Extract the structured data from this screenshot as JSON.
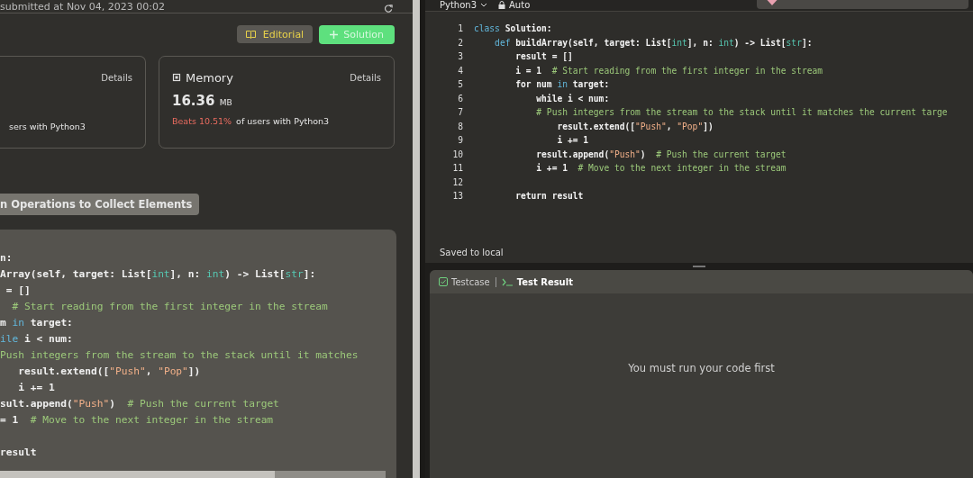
{
  "left": {
    "submitted": "submitted at Nov 04, 2023 00:02",
    "editorial": "Editorial",
    "solution": "Solution",
    "cards": [
      {
        "kind": "runtime",
        "details": "Details",
        "rest": "sers with Python3"
      },
      {
        "kind": "memory",
        "title": "Memory",
        "details": "Details",
        "value": "16.36",
        "unit": "MB",
        "beats": "Beats 10.51%",
        "rest": "of users with Python3"
      }
    ],
    "problem_title": "n Operations to Collect Elements",
    "code_lines": [
      {
        "kind": "code",
        "segments": [
          {
            "kind": "plain",
            "text": "n:"
          }
        ]
      },
      {
        "kind": "code",
        "segments": [
          {
            "kind": "plain",
            "text": "Array(self, target: List["
          },
          {
            "kind": "type",
            "text": "int"
          },
          {
            "kind": "plain",
            "text": "], n: "
          },
          {
            "kind": "type",
            "text": "int"
          },
          {
            "kind": "plain",
            "text": ") -> List["
          },
          {
            "kind": "type",
            "text": "str"
          },
          {
            "kind": "plain",
            "text": "]:"
          }
        ]
      },
      {
        "kind": "code",
        "segments": [
          {
            "kind": "plain",
            "text": " = []"
          }
        ]
      },
      {
        "kind": "code",
        "segments": [
          {
            "kind": "comment",
            "text": "  # Start reading from the first integer in the stream"
          }
        ]
      },
      {
        "kind": "code",
        "segments": [
          {
            "kind": "plain",
            "text": "m "
          },
          {
            "kind": "keyword",
            "text": "in"
          },
          {
            "kind": "plain",
            "text": " target:"
          }
        ]
      },
      {
        "kind": "code",
        "segments": [
          {
            "kind": "keyword",
            "text": "ile"
          },
          {
            "kind": "plain",
            "text": " i < num:"
          }
        ]
      },
      {
        "kind": "code",
        "segments": [
          {
            "kind": "comment",
            "text": "Push integers from the stream to the stack until it matches"
          }
        ]
      },
      {
        "kind": "code",
        "segments": [
          {
            "kind": "plain",
            "text": "   result.extend(["
          },
          {
            "kind": "string",
            "text": "\"Push\""
          },
          {
            "kind": "plain",
            "text": ", "
          },
          {
            "kind": "string",
            "text": "\"Pop\""
          },
          {
            "kind": "plain",
            "text": "])"
          }
        ]
      },
      {
        "kind": "code",
        "segments": [
          {
            "kind": "plain",
            "text": "   i += 1"
          }
        ]
      },
      {
        "kind": "code",
        "segments": [
          {
            "kind": "plain",
            "text": "sult.append("
          },
          {
            "kind": "string",
            "text": "\"Push\""
          },
          {
            "kind": "plain",
            "text": ")  "
          },
          {
            "kind": "comment",
            "text": "# Push the current target"
          }
        ]
      },
      {
        "kind": "code",
        "segments": [
          {
            "kind": "plain",
            "text": "= 1  "
          },
          {
            "kind": "comment",
            "text": "# Move to the next integer in the stream"
          }
        ]
      },
      {
        "kind": "blank"
      },
      {
        "kind": "code",
        "segments": [
          {
            "kind": "plain",
            "text": "result"
          }
        ]
      }
    ]
  },
  "editor": {
    "language": "Python3",
    "mode": "Auto",
    "lines": [
      {
        "number": "1",
        "segments": [
          {
            "kind": "keyword",
            "text": "class"
          },
          {
            "kind": "plain",
            "text": " Solution:"
          }
        ]
      },
      {
        "number": "2",
        "segments": [
          {
            "kind": "keyword",
            "text": "    def"
          },
          {
            "kind": "plain",
            "text": " buildArray(self, target: List["
          },
          {
            "kind": "type",
            "text": "int"
          },
          {
            "kind": "plain",
            "text": "], n: "
          },
          {
            "kind": "type",
            "text": "int"
          },
          {
            "kind": "plain",
            "text": ") -> List["
          },
          {
            "kind": "type",
            "text": "str"
          },
          {
            "kind": "plain",
            "text": "]:"
          }
        ]
      },
      {
        "number": "3",
        "segments": [
          {
            "kind": "plain",
            "text": "        result = []"
          }
        ]
      },
      {
        "number": "4",
        "segments": [
          {
            "kind": "plain",
            "text": "        i = 1  "
          },
          {
            "kind": "comment",
            "text": "# Start reading from the first integer in the stream"
          }
        ]
      },
      {
        "number": "5",
        "segments": [
          {
            "kind": "plain",
            "text": "        for num "
          },
          {
            "kind": "keyword",
            "text": "in"
          },
          {
            "kind": "plain",
            "text": " target:"
          }
        ]
      },
      {
        "number": "6",
        "segments": [
          {
            "kind": "plain",
            "text": "            while i < num:"
          }
        ]
      },
      {
        "number": "7",
        "segments": [
          {
            "kind": "comment",
            "text": "            # Push integers from the stream to the stack until it matches the current targe"
          }
        ]
      },
      {
        "number": "8",
        "segments": [
          {
            "kind": "plain",
            "text": "                result.extend(["
          },
          {
            "kind": "string",
            "text": "\"Push\""
          },
          {
            "kind": "plain",
            "text": ", "
          },
          {
            "kind": "string",
            "text": "\"Pop\""
          },
          {
            "kind": "plain",
            "text": "])"
          }
        ]
      },
      {
        "number": "9",
        "segments": [
          {
            "kind": "plain",
            "text": "                i += 1"
          }
        ]
      },
      {
        "number": "10",
        "segments": [
          {
            "kind": "plain",
            "text": "            result.append("
          },
          {
            "kind": "string",
            "text": "\"Push\""
          },
          {
            "kind": "plain",
            "text": ")  "
          },
          {
            "kind": "comment",
            "text": "# Push the current target"
          }
        ]
      },
      {
        "number": "11",
        "segments": [
          {
            "kind": "plain",
            "text": "            i += 1  "
          },
          {
            "kind": "comment",
            "text": "# Move to the next integer in the stream"
          }
        ]
      },
      {
        "number": "12"
      },
      {
        "number": "13",
        "segments": [
          {
            "kind": "plain",
            "text": "        return result"
          }
        ]
      }
    ],
    "status": "Saved to local"
  },
  "console": {
    "tabs": [
      {
        "label": "Testcase",
        "kind": "testcase",
        "selected": false
      },
      {
        "label": "Test Result",
        "kind": "result",
        "selected": true
      }
    ],
    "message": "You must run your code first"
  }
}
